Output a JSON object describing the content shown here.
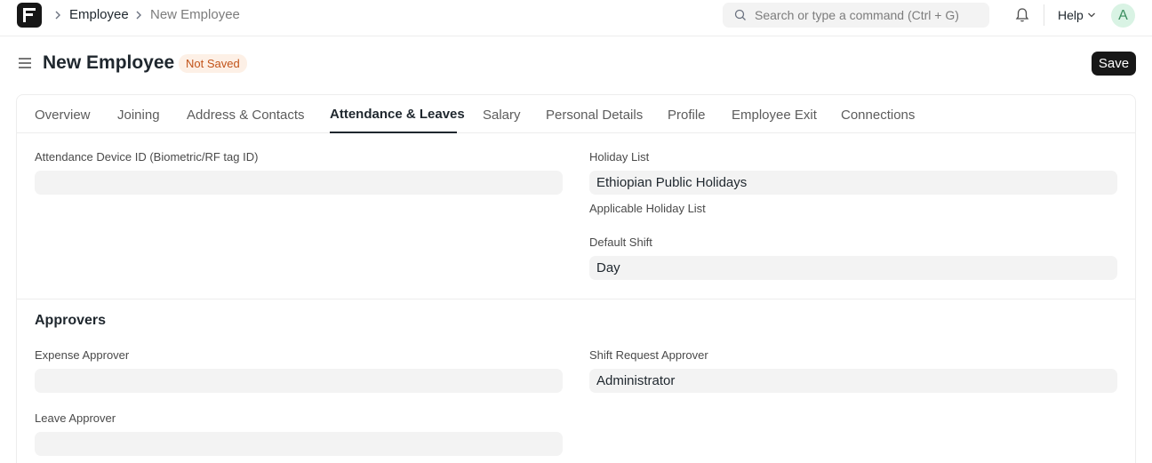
{
  "navbar": {
    "breadcrumbs": [
      "Employee",
      "New Employee"
    ],
    "search_placeholder": "Search or type a command (Ctrl + G)",
    "help_label": "Help",
    "avatar_initial": "A"
  },
  "page": {
    "title": "New Employee",
    "status_badge": "Not Saved",
    "save_label": "Save"
  },
  "tabs": [
    "Overview",
    "Joining",
    "Address & Contacts",
    "Attendance & Leaves",
    "Salary",
    "Personal Details",
    "Profile",
    "Employee Exit",
    "Connections"
  ],
  "active_tab": "Attendance & Leaves",
  "attendance": {
    "device_id_label": "Attendance Device ID (Biometric/RF tag ID)",
    "device_id_value": "",
    "holiday_list_label": "Holiday List",
    "holiday_list_value": "Ethiopian Public Holidays",
    "holiday_list_hint": "Applicable Holiday List",
    "default_shift_label": "Default Shift",
    "default_shift_value": "Day"
  },
  "approvers": {
    "section_title": "Approvers",
    "expense_approver_label": "Expense Approver",
    "expense_approver_value": "",
    "shift_request_approver_label": "Shift Request Approver",
    "shift_request_approver_value": "Administrator",
    "leave_approver_label": "Leave Approver",
    "leave_approver_value": ""
  },
  "colors": {
    "accent_dark": "#171717",
    "badge_bg": "#fdf0e6",
    "badge_text": "#c2541a",
    "avatar_bg": "#d9f3e4"
  }
}
